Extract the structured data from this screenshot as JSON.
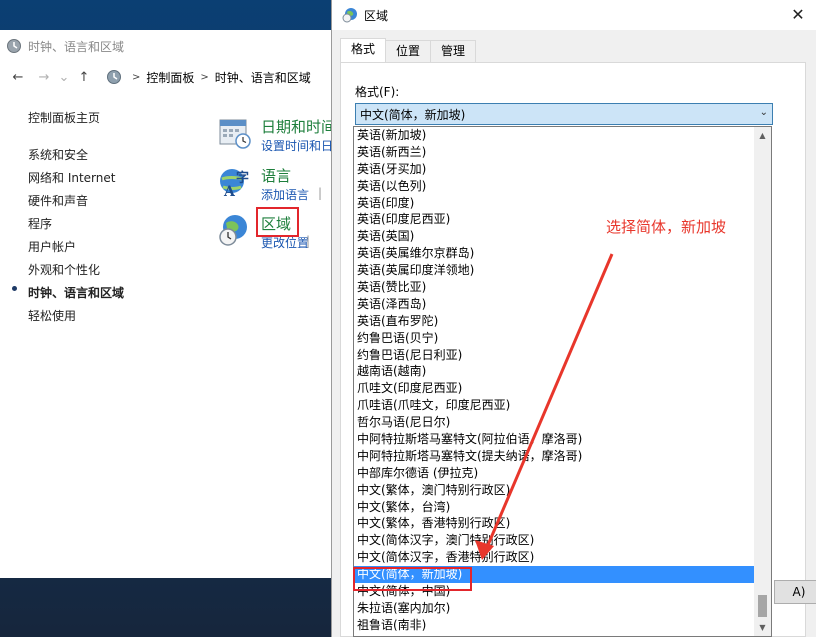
{
  "control_panel": {
    "window_title": "时钟、语言和区域",
    "nav": {
      "back": "←",
      "forward": "→",
      "recent": "⌄",
      "up": "↑"
    },
    "breadcrumb": [
      "控制面板",
      "时钟、语言和区域"
    ],
    "sidebar": {
      "home": "控制面板主页",
      "items": [
        "系统和安全",
        "网络和 Internet",
        "硬件和声音",
        "程序",
        "用户帐户",
        "外观和个性化",
        "时钟、语言和区域",
        "轻松使用"
      ]
    },
    "categories": [
      {
        "title": "日期和时间",
        "sub1": "设置时间和日期",
        "sub2": ""
      },
      {
        "title": "语言",
        "sub1": "添加语言",
        "sub2": ""
      },
      {
        "title": "区域",
        "sub1": "更改位置",
        "sub2": ""
      }
    ]
  },
  "region_dialog": {
    "title": "区域",
    "close": "✕",
    "tabs": [
      "格式",
      "位置",
      "管理"
    ],
    "format_label": "格式(F):",
    "selected_format": "中文(简体，新加坡)",
    "button_partial": "A)"
  },
  "dropdown": {
    "items": [
      "英语(新加坡)",
      "英语(新西兰)",
      "英语(牙买加)",
      "英语(以色列)",
      "英语(印度)",
      "英语(印度尼西亚)",
      "英语(英国)",
      "英语(英属维尔京群岛)",
      "英语(英属印度洋领地)",
      "英语(赞比亚)",
      "英语(泽西岛)",
      "英语(直布罗陀)",
      "约鲁巴语(贝宁)",
      "约鲁巴语(尼日利亚)",
      "越南语(越南)",
      "爪哇文(印度尼西亚)",
      "爪哇语(爪哇文，印度尼西亚)",
      "哲尔马语(尼日尔)",
      "中阿特拉斯塔马塞特文(阿拉伯语，摩洛哥)",
      "中阿特拉斯塔马塞特文(提夫纳语，摩洛哥)",
      "中部库尔德语 (伊拉克)",
      "中文(繁体，澳门特别行政区)",
      "中文(繁体，台湾)",
      "中文(繁体，香港特别行政区)",
      "中文(简体汉字，澳门特别行政区)",
      "中文(简体汉字，香港特别行政区)",
      "中文(简体，新加坡)",
      "中文(简体，中国)",
      "朱拉语(塞内加尔)",
      "祖鲁语(南非)"
    ],
    "selected_index": 26
  },
  "annotation": {
    "text": "选择简体，新加坡",
    "color": "#e8362b"
  }
}
